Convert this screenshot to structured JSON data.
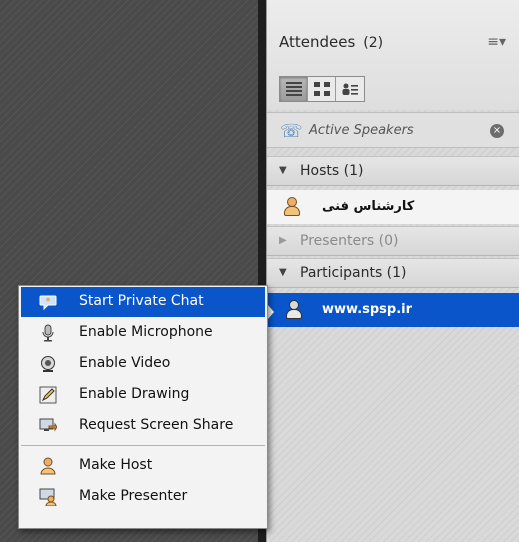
{
  "panel": {
    "title": "Attendees",
    "count": "(2)",
    "menu_icon": "≡▾",
    "view_modes": [
      "list-view-icon",
      "grid-view-icon",
      "attendee-list-icon"
    ]
  },
  "active_speakers": {
    "label": "Active Speakers",
    "close_glyph": "×"
  },
  "sections": {
    "hosts": {
      "label": "Hosts (1)",
      "expanded": true
    },
    "presenters": {
      "label": "Presenters (0)",
      "expanded": false
    },
    "participants": {
      "label": "Participants (1)",
      "expanded": true
    }
  },
  "attendees": {
    "host": {
      "name": "کارشناس فنی"
    },
    "participant": {
      "name": "www.spsp.ir"
    }
  },
  "context_menu": {
    "items": [
      {
        "label": "Start Private Chat",
        "icon": "chat-bubble-icon"
      },
      {
        "label": "Enable Microphone",
        "icon": "microphone-icon"
      },
      {
        "label": "Enable Video",
        "icon": "webcam-icon"
      },
      {
        "label": "Enable Drawing",
        "icon": "pencil-icon"
      },
      {
        "label": "Request Screen Share",
        "icon": "screen-share-icon"
      },
      {
        "label": "Make Host",
        "icon": "host-icon"
      },
      {
        "label": "Make Presenter",
        "icon": "presenter-icon"
      }
    ]
  },
  "colors": {
    "selection": "#0a55c9",
    "panel_bg": "#d9d9d9",
    "stage_bg": "#4a4a4a"
  }
}
